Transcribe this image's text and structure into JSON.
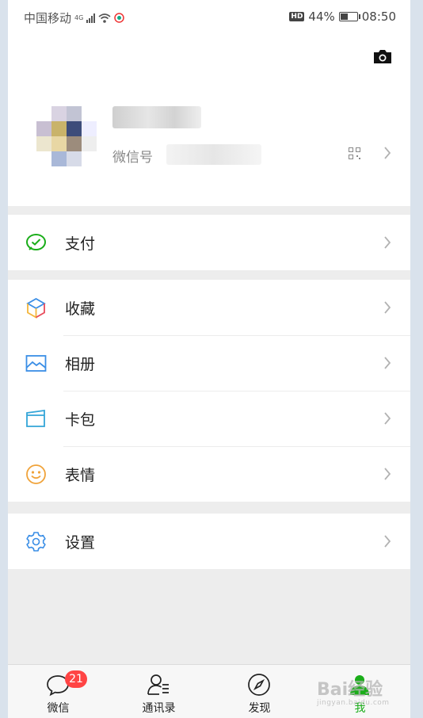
{
  "status_bar": {
    "carrier": "中国移动",
    "network": "4G",
    "hd_label": "HD",
    "battery": "44%",
    "battery_level": 0.44,
    "time": "08:50"
  },
  "profile": {
    "wechat_id_label": "微信号"
  },
  "menu": {
    "pay": "支付",
    "favorites": "收藏",
    "album": "相册",
    "cards": "卡包",
    "stickers": "表情",
    "settings": "设置"
  },
  "tabs": [
    {
      "label": "微信",
      "badge": "21",
      "icon": "chat-bubble-icon"
    },
    {
      "label": "通讯录",
      "icon": "contacts-icon"
    },
    {
      "label": "发现",
      "icon": "compass-icon"
    },
    {
      "label": "我",
      "icon": "me-icon",
      "active": true
    }
  ],
  "watermark": {
    "text": "Bai经验",
    "url": "jingyan.baidu.com"
  },
  "colors": {
    "active_tab": "#1aad19",
    "badge": "#f44444"
  }
}
